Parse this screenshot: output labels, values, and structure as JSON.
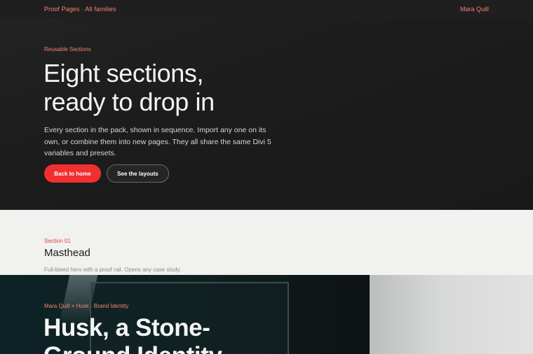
{
  "topbar": {
    "brand": "Proof Pages · All families",
    "user": "Mara Quill"
  },
  "hero": {
    "eyebrow": "Reusable Sections",
    "title_line1": "Eight sections,",
    "title_line2": "ready to drop in",
    "description": "Every section in the pack, shown in sequence. Import any one on its own, or combine them into new pages. They all share the same Divi 5 variables and presets.",
    "primary_button": "Back to home",
    "secondary_button": "See the layouts"
  },
  "section": {
    "number": "Section 01",
    "title": "Masthead",
    "description": "Full-bleed hero with a proof rail. Opens any case study."
  },
  "preview": {
    "eyebrow": "Mara Quill × Husk · Brand Identity",
    "title_line1": "Husk, a Stone-",
    "title_line2": "Ground Identity"
  },
  "colors": {
    "accent": "#f2846d",
    "primary_button": "#f0302e",
    "hero_bg": "#1b1b1b",
    "section_bg": "#f1f1ef"
  }
}
